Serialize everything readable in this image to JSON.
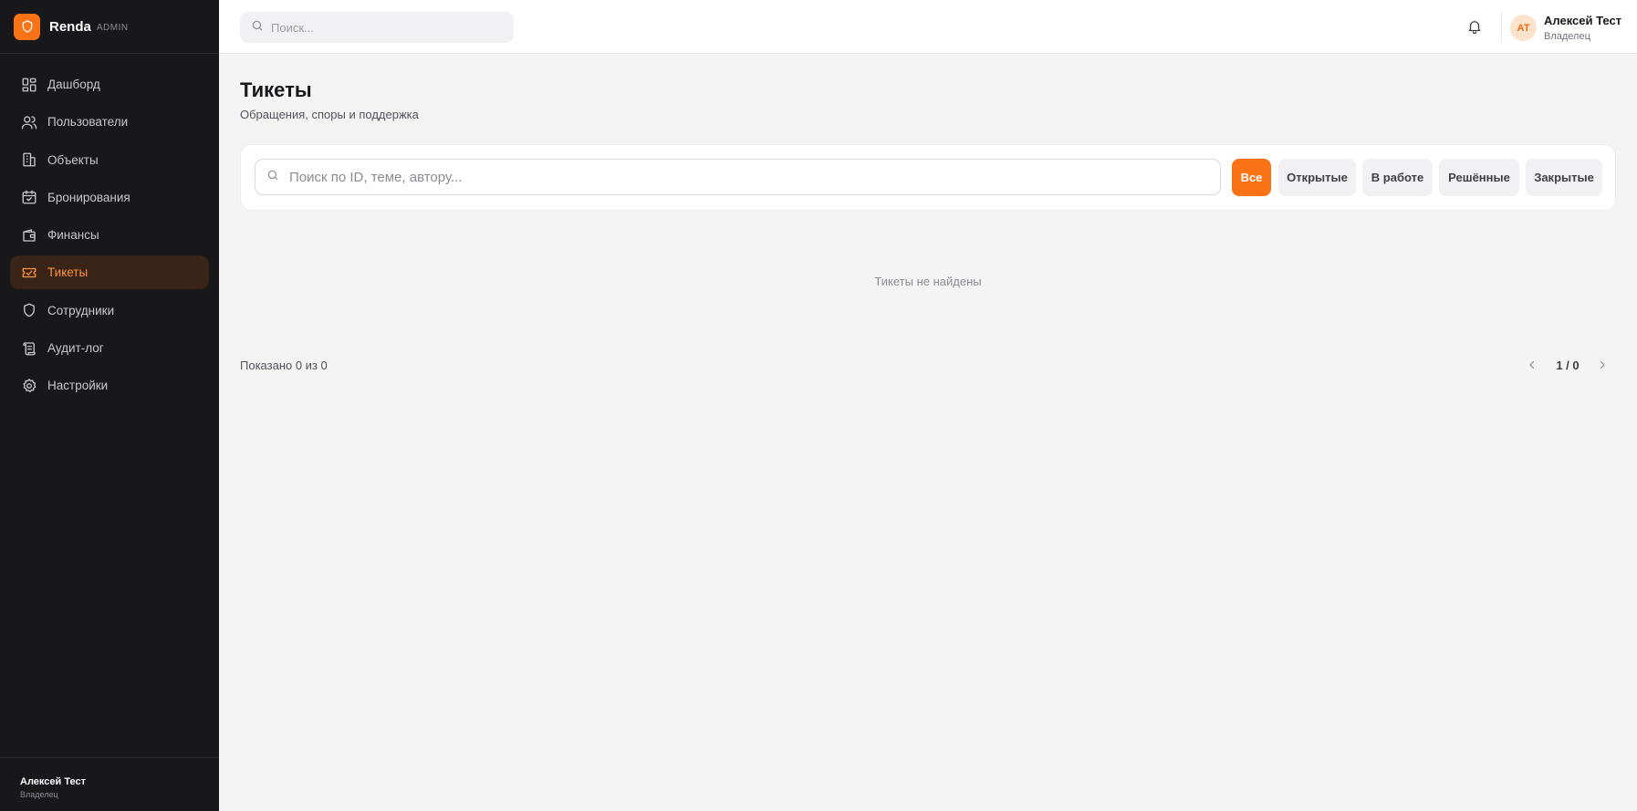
{
  "brand": {
    "name": "Renda",
    "tag": "ADMIN",
    "logo_icon": "shield-icon",
    "accent": "#f97316"
  },
  "sidebar": {
    "items": [
      {
        "label": "Дашборд",
        "icon": "dashboard-grid-icon",
        "active": false
      },
      {
        "label": "Пользователи",
        "icon": "users-icon",
        "active": false
      },
      {
        "label": "Объекты",
        "icon": "buildings-icon",
        "active": false
      },
      {
        "label": "Бронирования",
        "icon": "calendar-check-icon",
        "active": false
      },
      {
        "label": "Финансы",
        "icon": "wallet-icon",
        "active": false
      },
      {
        "label": "Тикеты",
        "icon": "ticket-icon",
        "active": true
      },
      {
        "label": "Сотрудники",
        "icon": "shield-icon",
        "active": false
      },
      {
        "label": "Аудит-лог",
        "icon": "scroll-icon",
        "active": false
      },
      {
        "label": "Настройки",
        "icon": "gear-icon",
        "active": false
      }
    ],
    "footer": {
      "name": "Алексей Тест",
      "role": "Владелец"
    }
  },
  "topbar": {
    "search_placeholder": "Поиск...",
    "notifications_icon": "bell-icon",
    "user": {
      "initials": "АТ",
      "name": "Алексей Тест",
      "role": "Владелец"
    }
  },
  "page": {
    "title": "Тикеты",
    "subtitle": "Обращения, споры и поддержка"
  },
  "filters": {
    "search_placeholder": "Поиск по ID, теме, автору...",
    "buttons": [
      {
        "label": "Все",
        "active": true
      },
      {
        "label": "Открытые",
        "active": false
      },
      {
        "label": "В работе",
        "active": false
      },
      {
        "label": "Решённые",
        "active": false
      },
      {
        "label": "Закрытые",
        "active": false
      }
    ]
  },
  "empty_state": "Тикеты не найдены",
  "pagination": {
    "shown": "Показано 0 из 0",
    "page_indicator": "1 / 0"
  }
}
